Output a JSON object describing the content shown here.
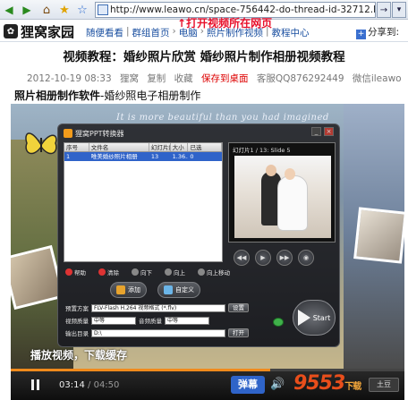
{
  "browser": {
    "url": "http://www.leawo.cn/space-756442-do-thread-id-32712.html",
    "go_glyph": "→",
    "menu_glyph": "▾"
  },
  "site": {
    "logo_text": "狸窝家园",
    "nav": [
      "随便看看",
      "群组首页",
      "电脑",
      "照片制作视频",
      "教程中心"
    ],
    "share_label": "分享到:"
  },
  "annotations": {
    "url_note": "打开视频所在网页",
    "play_note": "播放视频，下载缓存"
  },
  "article": {
    "title": "视频教程：婚纱照片欣赏 婚纱照片制作相册视频教程",
    "date": "2012-10-19 08:33",
    "actions": [
      "狸窝",
      "复制",
      "收藏"
    ],
    "save_desktop": "保存到桌面",
    "service_qq": "客服QQ876292449",
    "wechat": "微信ileawo",
    "subtitle_bold": "照片相册制作软件",
    "subtitle_rest": "-婚纱照电子相册制作"
  },
  "video": {
    "banner_text": "It is more beautiful than you had imagined",
    "app": {
      "title": "狸窝PPT转换器",
      "list_headers": [
        "序号",
        "文件名",
        "幻灯片数",
        "大小",
        "已选"
      ],
      "list_row": [
        "1",
        "唯美婚纱照片相册",
        "13",
        "1.36...",
        "0"
      ],
      "preview_label": "幻灯片1 / 13: Slide 5",
      "tools": [
        "帮助",
        "清除",
        "向下",
        "向上",
        "向上移动"
      ],
      "add_button": "添加",
      "custom_button": "自定义",
      "form": {
        "preset_label": "预置方案",
        "preset_value": "FLV-Flash H.264 视频格式 (*.flv)",
        "video_quality_label": "视频质量",
        "video_quality_value": "中等",
        "audio_quality_label": "音频质量",
        "audio_quality_value": "中等",
        "output_label": "输出目录",
        "output_value": "D:\\",
        "settings_button": "设置",
        "open_button": "打开"
      },
      "start_button": "Start"
    }
  },
  "player": {
    "progress_fraction": 0.66,
    "current_time": "03:14",
    "duration": "04:50",
    "danmu_label": "弹幕",
    "site_logo": "9553",
    "site_logo_sub": "下载",
    "right_badge": "土豆"
  },
  "colors": {
    "annotation_red": "#e8102b",
    "link_blue": "#1a4fa0",
    "progress_orange": "#f08a1c",
    "danmu_blue": "#2f64c9"
  }
}
